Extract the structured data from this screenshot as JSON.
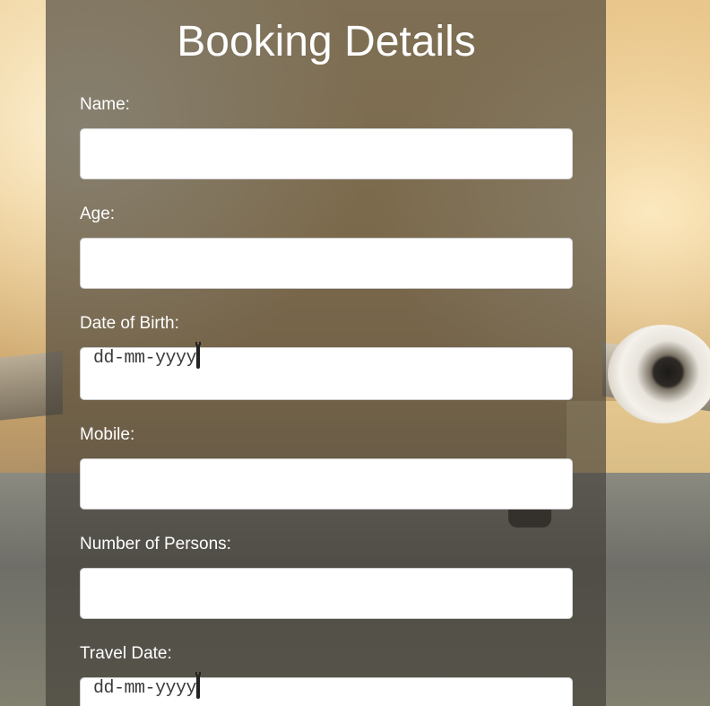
{
  "form": {
    "title": "Booking Details",
    "fields": [
      {
        "label": "Name:",
        "value": ""
      },
      {
        "label": "Age:",
        "value": ""
      },
      {
        "label": "Date of Birth:",
        "placeholder": "dd-mm-yyyy"
      },
      {
        "label": "Mobile:",
        "value": ""
      },
      {
        "label": "Number of Persons:",
        "value": ""
      },
      {
        "label": "Travel Date:",
        "placeholder": "dd-mm-yyyy"
      }
    ]
  },
  "icons": {
    "date_picker": "calendar-icon"
  }
}
